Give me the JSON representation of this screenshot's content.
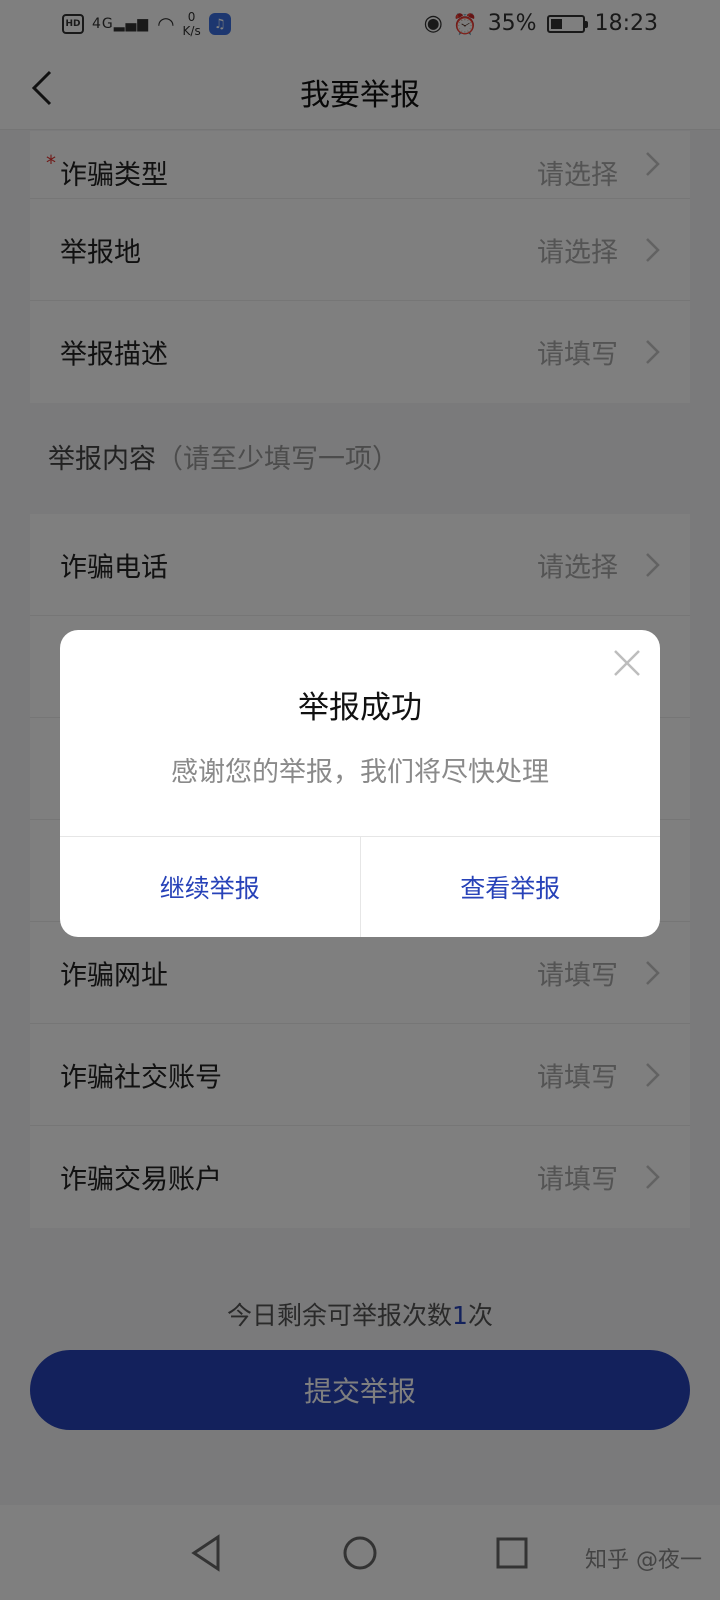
{
  "status_bar": {
    "hd": "HD",
    "network": "4G",
    "speed_value": "0",
    "speed_unit": "K/s",
    "battery": "35%",
    "time": "18:23"
  },
  "nav": {
    "title": "我要举报"
  },
  "form_top": [
    {
      "label": "诈骗类型",
      "required": true,
      "value": "请选择"
    },
    {
      "label": "举报地",
      "value": "请选择"
    },
    {
      "label": "举报描述",
      "value": "请填写"
    }
  ],
  "section": {
    "title": "举报内容",
    "hint": "（请至少填写一项）"
  },
  "form_content": [
    {
      "label": "诈骗电话",
      "value": "请选择"
    },
    {
      "label": "",
      "value": ""
    },
    {
      "label": "",
      "value": ""
    },
    {
      "label": "",
      "value": ""
    },
    {
      "label": "诈骗网址",
      "value": "请填写"
    },
    {
      "label": "诈骗社交账号",
      "value": "请填写"
    },
    {
      "label": "诈骗交易账户",
      "value": "请填写"
    }
  ],
  "remaining": {
    "prefix": "今日剩余可举报次数",
    "count": "1",
    "suffix": "次"
  },
  "submit_label": "提交举报",
  "dialog": {
    "title": "举报成功",
    "message": "感谢您的举报，我们将尽快处理",
    "continue_label": "继续举报",
    "view_label": "查看举报"
  },
  "watermark": "知乎 @夜一",
  "colors": {
    "accent": "#2742b8",
    "required": "#e0322f"
  }
}
